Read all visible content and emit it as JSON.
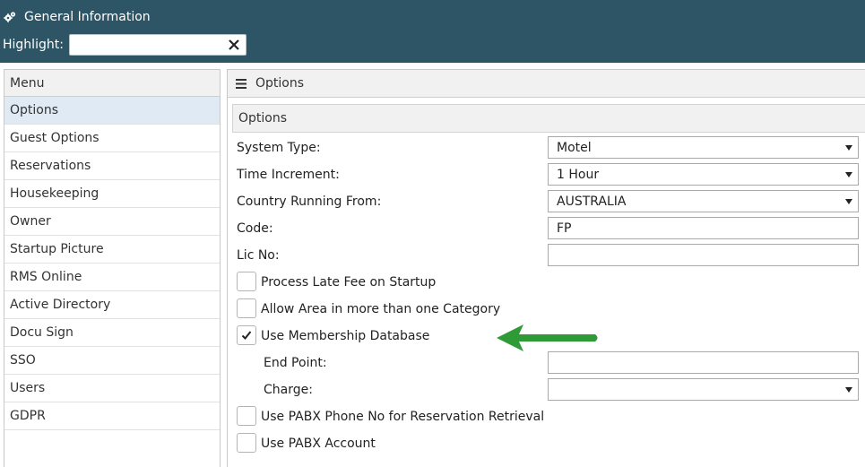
{
  "header": {
    "title": "General Information",
    "highlight_label": "Highlight:",
    "highlight_value": "",
    "clear_icon": "close-icon",
    "title_icon": "gears-icon"
  },
  "menu": {
    "heading": "Menu",
    "items": [
      "Options",
      "Guest Options",
      "Reservations",
      "Housekeeping",
      "Owner",
      "Startup Picture",
      "RMS Online",
      "Active Directory",
      "Docu Sign",
      "SSO",
      "Users",
      "GDPR"
    ],
    "active": "Options"
  },
  "panel": {
    "title": "Options",
    "title_icon": "hamburger-menu-icon",
    "section_title": "Options"
  },
  "form": {
    "system_type": {
      "label": "System Type:",
      "value": "Motel"
    },
    "time_increment": {
      "label": "Time Increment:",
      "value": "1 Hour"
    },
    "country": {
      "label": "Country Running From:",
      "value": "AUSTRALIA"
    },
    "code": {
      "label": "Code:",
      "value": "FP"
    },
    "lic_no": {
      "label": "Lic No:",
      "value": ""
    },
    "process_late_fee": {
      "label": "Process Late Fee on Startup",
      "checked": false
    },
    "allow_area": {
      "label": "Allow Area in more than one Category",
      "checked": false
    },
    "use_membership": {
      "label": "Use Membership Database",
      "checked": true
    },
    "end_point": {
      "label": "End Point:",
      "value": ""
    },
    "charge": {
      "label": "Charge:",
      "value": ""
    },
    "use_pabx_phone": {
      "label": "Use PABX Phone No for Reservation Retrieval",
      "checked": false
    },
    "use_pabx_account": {
      "label": "Use PABX Account",
      "checked": false
    }
  },
  "colors": {
    "header_bg": "#2d5566",
    "active_menu_bg": "#dfeaf4",
    "arrow": "#2e9b36"
  },
  "annotation_icon": "green-arrow-left-icon"
}
